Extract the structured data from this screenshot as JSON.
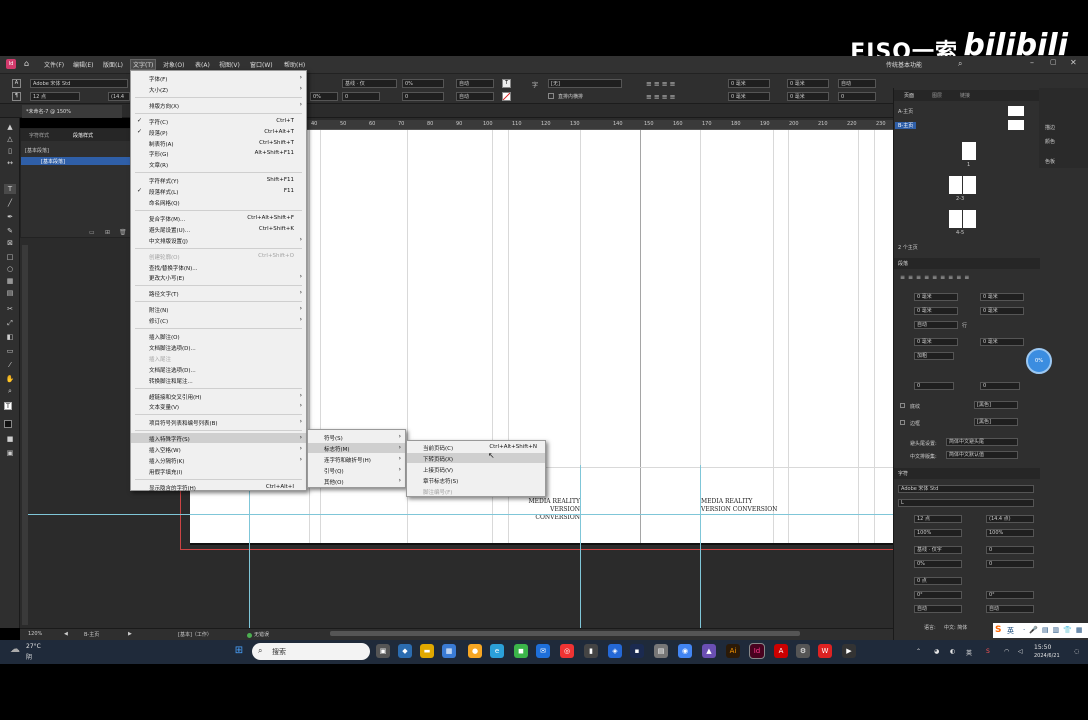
{
  "watermark": {
    "text": "EISO一索",
    "logo": "bilibili"
  },
  "menubar": {
    "items": [
      "文件(F)",
      "编辑(E)",
      "版面(L)",
      "文字(T)",
      "对象(O)",
      "表(A)",
      "视图(V)",
      "窗口(W)",
      "帮助(H)"
    ],
    "workspace": "传统基本功能"
  },
  "control": {
    "font": "Adobe 宋体 Std",
    "size": "12 点",
    "leading": "(14.4",
    "align_label": "基线 · 仅",
    "tracking": "0%",
    "auto1": "自动",
    "auto2": "自动",
    "auto3": "自动",
    "none_style": "[无]",
    "direct_row": "直排内横排",
    "mm1": "0 毫米",
    "mm2": "0 毫米",
    "mm3": "0 毫米",
    "mm4": "0 毫米",
    "num0a": "0",
    "num0b": "0",
    "pct0": "0%",
    "zero_a": "0"
  },
  "doc_tab": "*未命名-7 @ 150%",
  "left_panel": {
    "tabs": [
      "字符样式",
      "段落样式"
    ],
    "rows": [
      "[基本段落]",
      "[基本段落]"
    ]
  },
  "ruler": {
    "ticks": [
      "40",
      "50",
      "60",
      "70",
      "80",
      "90",
      "100",
      "110",
      "120",
      "130",
      "140",
      "150",
      "160",
      "170",
      "180",
      "190",
      "200",
      "210",
      "220",
      "230"
    ]
  },
  "page_footer": {
    "left": [
      "MEDIA REALITY",
      "VERSION CONVERSION"
    ],
    "right": [
      "MEDIA REALITY",
      "VERSION CONVERSION"
    ]
  },
  "status": {
    "zoom": "120%",
    "page": "B-主页",
    "style": "[基本]（工作）",
    "errors": "无错误"
  },
  "right_panel": {
    "pages_tabs": [
      "页面",
      "图层",
      "链接"
    ],
    "masters": [
      "A-主页",
      "B-主页"
    ],
    "page_labels": [
      "1",
      "2-3",
      "4-5"
    ],
    "pages_footer": "2 个主页",
    "side_items": [
      "描边",
      "颜色",
      "色板"
    ],
    "paragraph_title": "段落",
    "para_fields": [
      "0 毫米",
      "0 毫米",
      "0 毫米",
      "0 毫米",
      "0 毫米",
      "0 毫米",
      "自动",
      "行",
      "加粗",
      "0",
      "0"
    ],
    "shading": "底纹",
    "border": "边框",
    "swatch_none": "[黑色]",
    "kinsoku_label": "避头尾设置:",
    "kinsoku_value": "简体中文避头尾",
    "mojikumi_label": "中文排版集:",
    "mojikumi_value": "简体中文默认值",
    "char_title": "字符",
    "char_font": "Adobe 宋体 Std",
    "char_style": "L",
    "char_size": "12 点",
    "char_leading": "(14.4 点)",
    "char_vscale": "100%",
    "char_hscale": "100%",
    "char_align": "基线 · 仅字",
    "char_pct": "0%",
    "char_zero1": "0",
    "char_zero2": "0",
    "char_pt": "0 点",
    "char_deg1": "0°",
    "char_deg2": "0°",
    "char_auto1": "自动",
    "char_auto2": "自动",
    "language_label": "语言:",
    "language_value": "中文: 简体",
    "float_btn": "0%"
  },
  "main_menu": [
    {
      "label": "字体(F)",
      "arrow": true
    },
    {
      "label": "大小(Z)",
      "arrow": true
    },
    {
      "sep": true
    },
    {
      "label": "排版方向(X)",
      "arrow": true
    },
    {
      "sep": true
    },
    {
      "label": "字符(C)",
      "shortcut": "Ctrl+T",
      "check": true
    },
    {
      "label": "段落(P)",
      "shortcut": "Ctrl+Alt+T",
      "check": true
    },
    {
      "label": "制表符(A)",
      "shortcut": "Ctrl+Shift+T"
    },
    {
      "label": "字形(G)",
      "shortcut": "Alt+Shift+F11"
    },
    {
      "label": "文章(R)"
    },
    {
      "sep": true
    },
    {
      "label": "字符样式(Y)",
      "shortcut": "Shift+F11"
    },
    {
      "label": "段落样式(L)",
      "shortcut": "F11",
      "check": true
    },
    {
      "label": "命名网格(Q)"
    },
    {
      "sep": true
    },
    {
      "label": "复合字体(M)...",
      "shortcut": "Ctrl+Alt+Shift+F"
    },
    {
      "label": "避头尾设置(U)...",
      "shortcut": "Ctrl+Shift+K"
    },
    {
      "label": "中文排版设置(J)",
      "arrow": true
    },
    {
      "sep": true
    },
    {
      "label": "创建轮廓(O)",
      "shortcut": "Ctrl+Shift+O",
      "disabled": true
    },
    {
      "label": "查找/替换字体(N)..."
    },
    {
      "label": "更改大小写(E)",
      "arrow": true
    },
    {
      "sep": true
    },
    {
      "label": "路径文字(T)",
      "arrow": true
    },
    {
      "sep": true
    },
    {
      "label": "附注(N)",
      "arrow": true
    },
    {
      "label": "修订(C)",
      "arrow": true
    },
    {
      "sep": true
    },
    {
      "label": "插入脚注(O)"
    },
    {
      "label": "文档脚注选项(D)..."
    },
    {
      "label": "插入尾注",
      "disabled": true
    },
    {
      "label": "文档尾注选项(D)..."
    },
    {
      "label": "转换脚注和尾注..."
    },
    {
      "sep": true
    },
    {
      "label": "超链接和交叉引用(H)",
      "arrow": true
    },
    {
      "label": "文本变量(V)",
      "arrow": true
    },
    {
      "sep": true
    },
    {
      "label": "项目符号列表和编号列表(B)",
      "arrow": true
    },
    {
      "sep": true
    },
    {
      "label": "插入特殊字符(S)",
      "arrow": true,
      "highlight": true
    },
    {
      "label": "插入空格(W)",
      "arrow": true
    },
    {
      "label": "插入分隔符(K)",
      "arrow": true
    },
    {
      "label": "用假字填充(I)"
    },
    {
      "sep": true
    },
    {
      "label": "显示隐含的字符(H)",
      "shortcut": "Ctrl+Alt+I"
    }
  ],
  "submenu1": [
    {
      "label": "符号(S)",
      "arrow": true
    },
    {
      "label": "标志符(M)",
      "arrow": true,
      "highlight": true
    },
    {
      "label": "连字符和破折号(H)",
      "arrow": true
    },
    {
      "label": "引号(Q)",
      "arrow": true
    },
    {
      "label": "其他(O)",
      "arrow": true
    }
  ],
  "submenu2": [
    {
      "label": "当前页码(C)",
      "shortcut": "Ctrl+Alt+Shift+N"
    },
    {
      "label": "下转页码(X)",
      "highlight": true
    },
    {
      "label": "上接页码(V)"
    },
    {
      "label": "章节标志符(S)"
    },
    {
      "label": "脚注编号(F)",
      "disabled": true
    }
  ],
  "taskbar": {
    "weather_temp": "27°C",
    "weather_desc": "阴",
    "search": "搜索",
    "ime1": "英",
    "ime2": "中",
    "time": "15:50",
    "date": "2024/6/21"
  }
}
